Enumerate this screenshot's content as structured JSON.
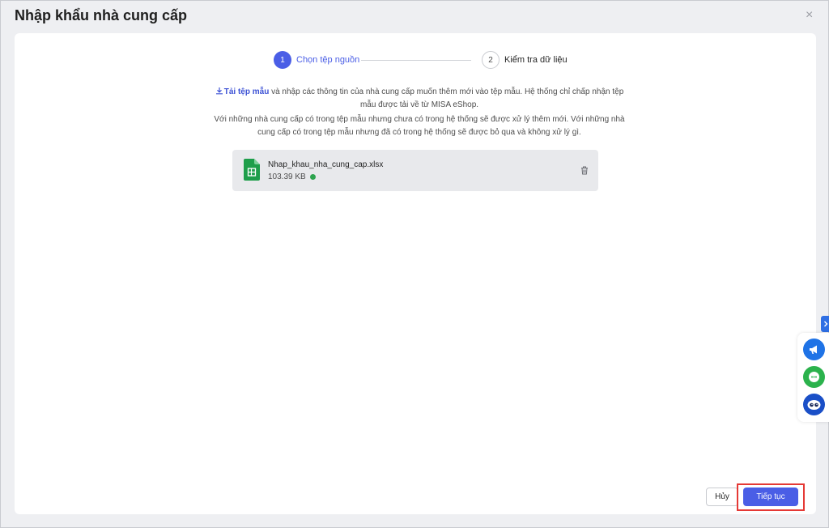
{
  "dialog": {
    "title": "Nhập khẩu nhà cung cấp",
    "close_glyph": "×"
  },
  "stepper": {
    "steps": [
      {
        "number": "1",
        "label": "Chọn tệp nguồn",
        "state": "active"
      },
      {
        "number": "2",
        "label": "Kiểm tra dữ liệu",
        "state": "pending"
      }
    ]
  },
  "description": {
    "download_link": "Tải tệp mẫu",
    "line1_rest": " và nhập các thông tin của nhà cung cấp muốn thêm mới vào tệp mẫu. Hệ thống chỉ chấp nhận tệp mẫu được tải về từ MISA eShop.",
    "line2": "Với những nhà cung cấp có trong tệp mẫu nhưng chưa có trong hệ thống sẽ được xử lý thêm mới. Với những nhà cung cấp có trong tệp mẫu nhưng đã có trong hệ thống sẽ được bỏ qua và không xử lý gì."
  },
  "file": {
    "name": "Nhap_khau_nha_cung_cap.xlsx",
    "size": "103.39 KB",
    "status": "valid",
    "icon": "spreadsheet-file-icon"
  },
  "footer": {
    "cancel_label": "Hủy",
    "continue_label": "Tiếp tục"
  },
  "side_widget": {
    "items": [
      "megaphone-icon",
      "chat-icon",
      "assistant-bot-icon"
    ]
  },
  "colors": {
    "accent": "#4a5ee6",
    "link": "#3d52d5",
    "success": "#2ea44f",
    "highlight": "#e53935",
    "sheet_green": "#1e9e4a"
  }
}
